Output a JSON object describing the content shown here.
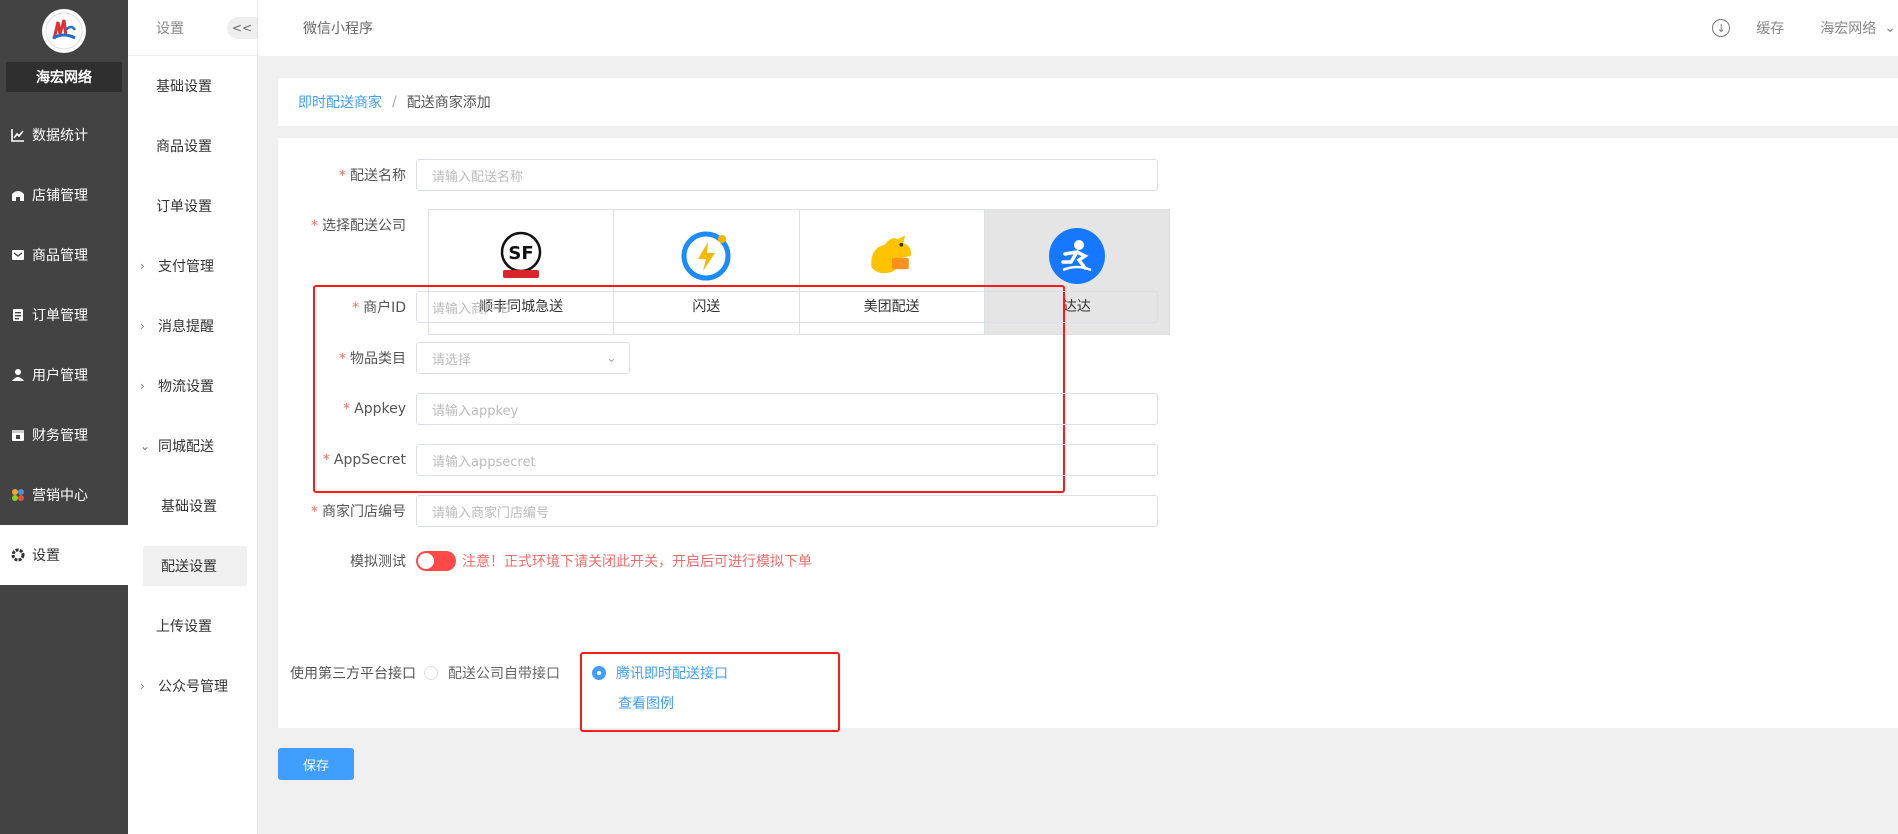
{
  "brand": {
    "name": "海宏网络"
  },
  "sidebar": {
    "items": [
      {
        "label": "数据统计",
        "icon": "chart-icon"
      },
      {
        "label": "店铺管理",
        "icon": "shop-icon"
      },
      {
        "label": "商品管理",
        "icon": "goods-icon"
      },
      {
        "label": "订单管理",
        "icon": "order-icon"
      },
      {
        "label": "用户管理",
        "icon": "user-icon"
      },
      {
        "label": "财务管理",
        "icon": "finance-icon"
      },
      {
        "label": "营销中心",
        "icon": "marketing-icon"
      },
      {
        "label": "设置",
        "icon": "gear-icon"
      }
    ]
  },
  "submenu": {
    "title": "设置",
    "collapse": "<<",
    "items": [
      {
        "label": "基础设置"
      },
      {
        "label": "商品设置"
      },
      {
        "label": "订单设置"
      },
      {
        "label": "支付管理"
      },
      {
        "label": "消息提醒"
      },
      {
        "label": "物流设置"
      },
      {
        "label": "同城配送"
      },
      {
        "label": "基础设置"
      },
      {
        "label": "配送设置"
      },
      {
        "label": "上传设置"
      },
      {
        "label": "公众号管理"
      }
    ]
  },
  "topbar": {
    "title": "微信小程序",
    "cache": "缓存",
    "user": "海宏网络"
  },
  "breadcrumb": {
    "parent": "即时配送商家",
    "separator": "/",
    "current": "配送商家添加"
  },
  "form": {
    "name": {
      "label": "配送名称",
      "placeholder": "请输入配送名称"
    },
    "company": {
      "label": "选择配送公司",
      "options": [
        {
          "name": "顺丰同城急送",
          "logo_text": "SF",
          "logo_sub": "顺丰同城急送"
        },
        {
          "name": "闪送"
        },
        {
          "name": "美团配送"
        },
        {
          "name": "达达"
        }
      ],
      "selected": "达达"
    },
    "merchant_id": {
      "label": "商户ID",
      "placeholder": "请输入商户ID"
    },
    "category": {
      "label": "物品类目",
      "placeholder": "请选择"
    },
    "appkey": {
      "label": "Appkey",
      "placeholder": "请输入appkey"
    },
    "appsecret": {
      "label": "AppSecret",
      "placeholder": "请输入appsecret"
    },
    "shop_no": {
      "label": "商家门店编号",
      "placeholder": "请输入商家门店编号"
    },
    "mock_test": {
      "label": "模拟测试",
      "warning": "注意！正式环境下请关闭此开关，开启后可进行模拟下单",
      "on": true
    },
    "third_party": {
      "label": "使用第三方平台接口",
      "option_self": "配送公司自带接口",
      "option_tencent": "腾讯即时配送接口",
      "view_example": "查看图例",
      "selected": "腾讯即时配送接口"
    },
    "save": "保存"
  },
  "colors": {
    "accent": "#409eff",
    "danger": "#f56c6c",
    "highlight_box": "#ff1a1a",
    "sidebar_bg": "#434343"
  }
}
